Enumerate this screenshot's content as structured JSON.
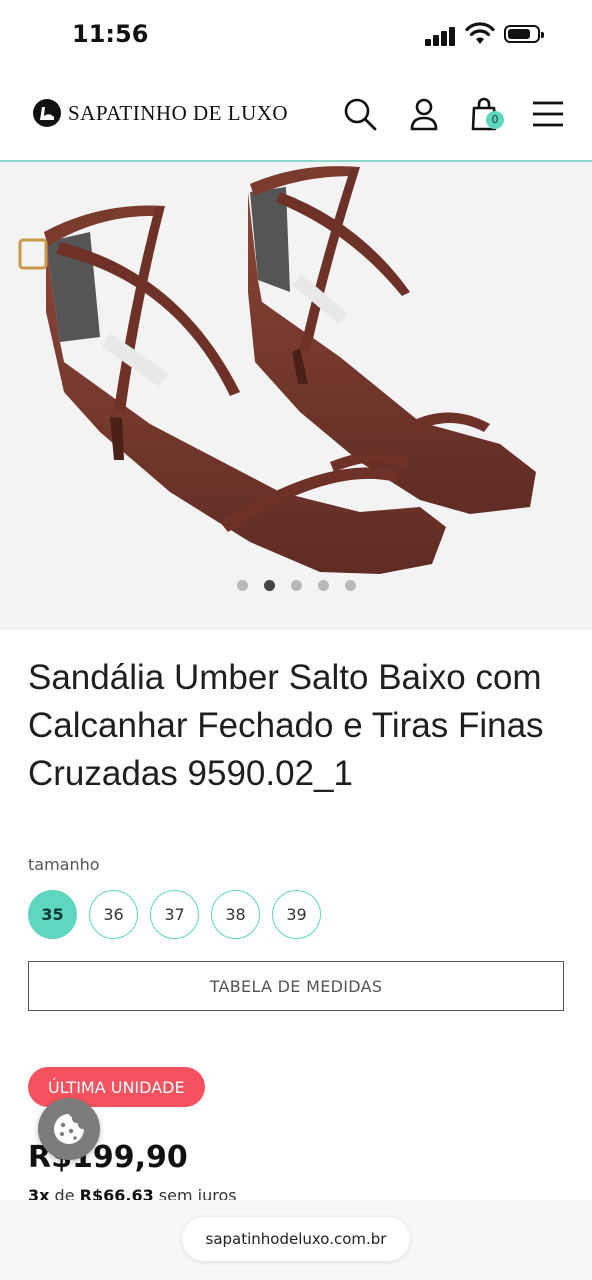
{
  "status_bar": {
    "time": "11:56"
  },
  "header": {
    "logo_text": "SAPATINHO DE LUXO",
    "cart_count": "0",
    "icons": [
      "search-icon",
      "user-icon",
      "cart-icon",
      "menu-icon"
    ]
  },
  "gallery": {
    "image_alt": "Sandália marrom com tiras finas cruzadas",
    "dots_count": 5,
    "active_dot": 2
  },
  "product": {
    "title": "Sandália Umber Salto Baixo com Calcanhar Fechado e Tiras Finas Cruzadas 9590.02_1",
    "size_label": "tamanho",
    "sizes": [
      "35",
      "36",
      "37",
      "38",
      "39"
    ],
    "selected_size": "35",
    "measure_button": "TABELA DE MEDIDAS",
    "stock_badge": "ÚLTIMA UNIDADE",
    "price": "R$199,90",
    "installment_count": "3x",
    "installment_mid": "de",
    "installment_value": "R$66,63",
    "installment_suffix": "sem juros"
  },
  "browser": {
    "url": "sapatinhodeluxo.com.br"
  },
  "colors": {
    "accent": "#5fd6c0",
    "badge": "#f4525e",
    "shoe": "#7a3a2e"
  }
}
